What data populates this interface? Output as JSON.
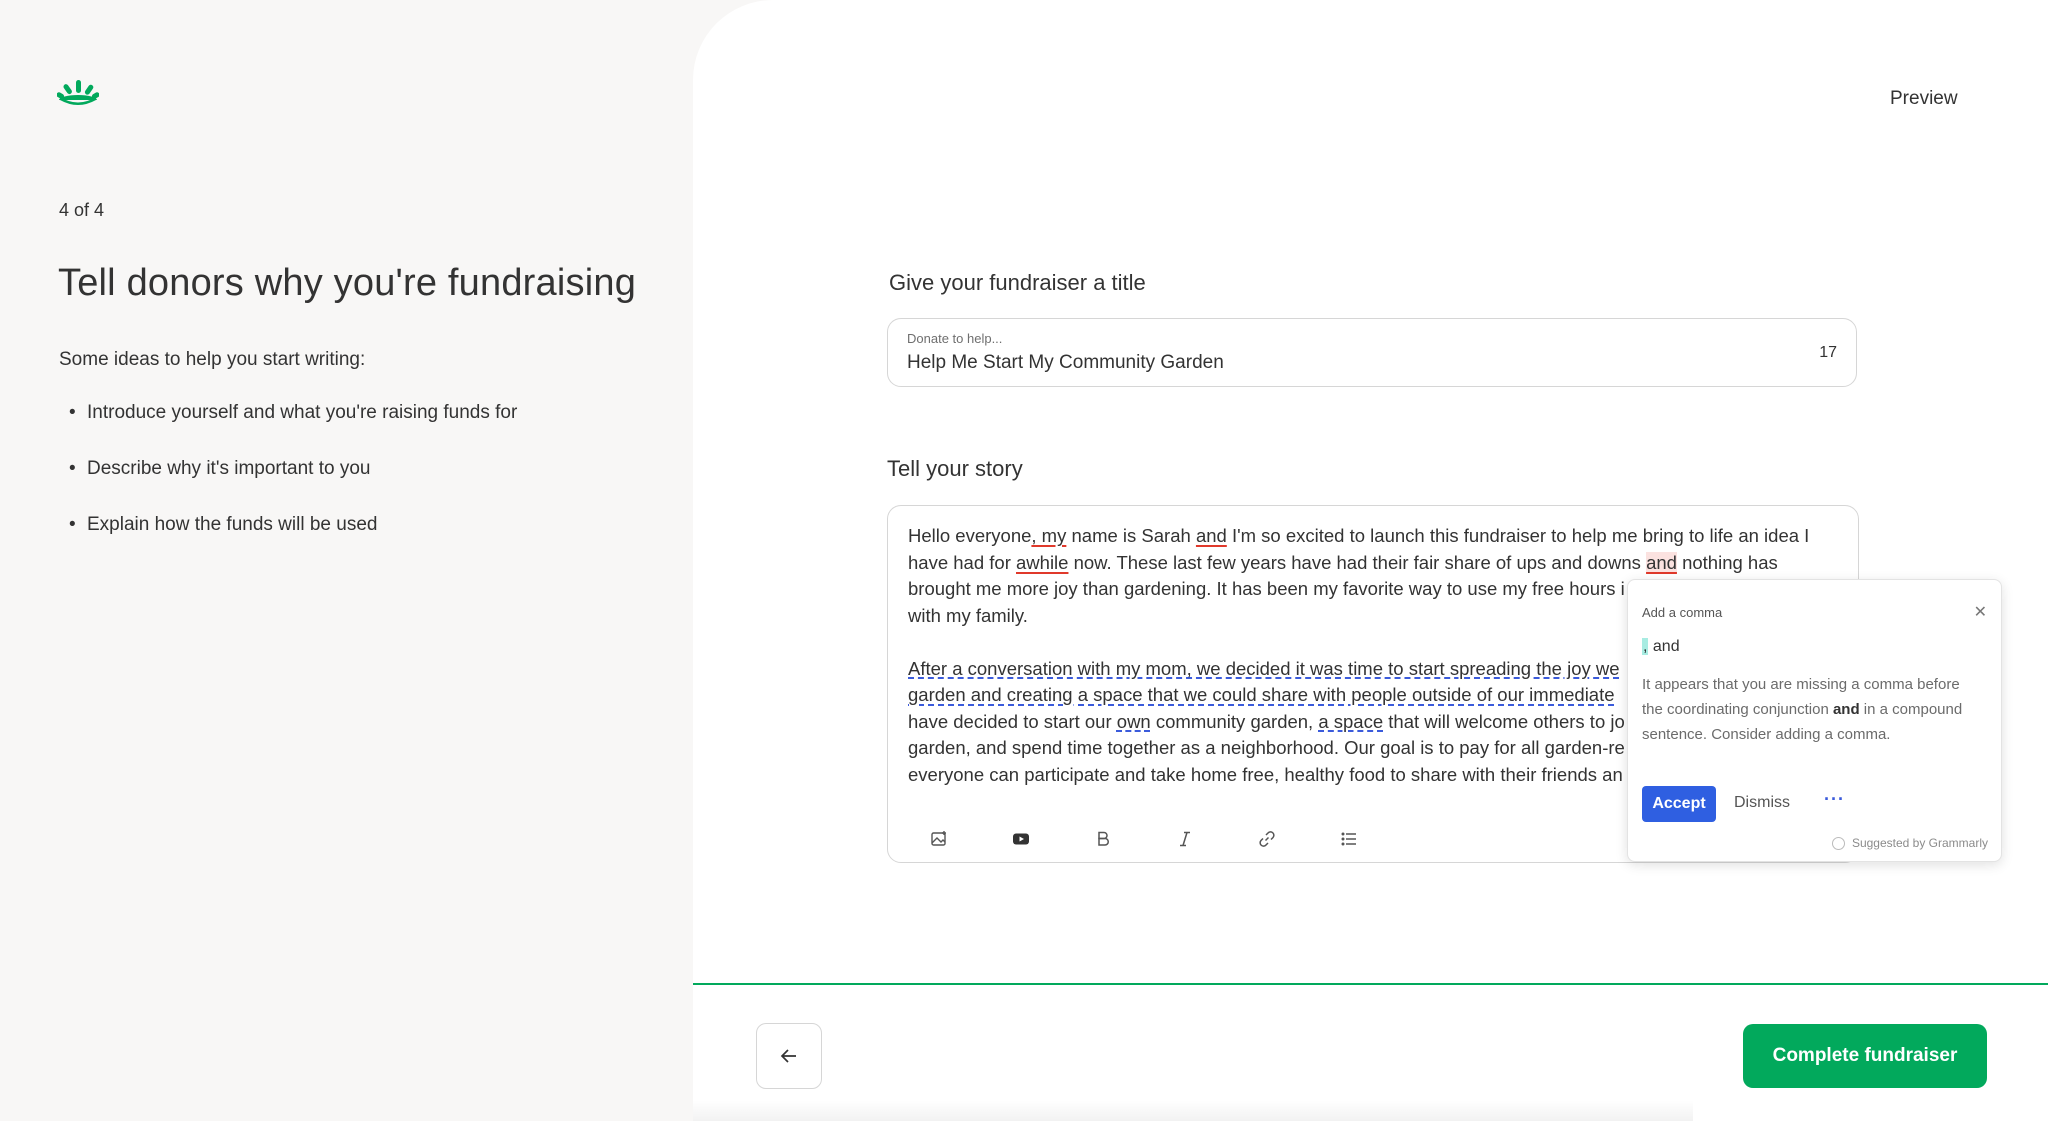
{
  "header": {
    "preview_label": "Preview"
  },
  "sidebar": {
    "step": "4 of 4",
    "heading": "Tell donors why you're fundraising",
    "ideas_label": "Some ideas to help you start writing:",
    "ideas": [
      "Introduce yourself and what you're raising funds for",
      "Describe why it's important to you",
      "Explain how the funds will be used"
    ]
  },
  "title_section": {
    "label": "Give your fundraiser a title",
    "placeholder": "Donate to help...",
    "value": "Help Me Start My Community Garden",
    "char_count": "17"
  },
  "story_section": {
    "label": "Tell your story",
    "p1": {
      "s1": "Hello everyone",
      "s2": ", my",
      "s3": " name is Sarah ",
      "s4": "and",
      "s5": " I'm so excited to launch this fundraiser to help me bring to life an idea I have had for ",
      "s6": "awhile",
      "s7": " now. These last few years have had their fair share of ups and downs ",
      "s8": "and",
      "s9": " nothing has brought me more joy than gardening. It has been my favorite way to use my free hours i",
      "s10": "with my family."
    },
    "p2": {
      "s1": "After a conversation with my mom, we decided it was time to start spreading the joy we",
      "s2": "garden and creating a space that we could share with people outside of our immediate",
      "s3": "have decided to start our ",
      "s4": "own",
      "s5": " community garden, ",
      "s6": "a space",
      "s7": " that will welcome others to jo",
      "s8": "garden, and spend time together as a neighborhood. Our goal is to pay for all garden-re",
      "s9": "everyone can participate and take home free, healthy food to share with their friends an"
    },
    "toolbar": [
      "image-icon",
      "video-icon",
      "bold-icon",
      "italic-icon",
      "link-icon",
      "list-icon"
    ]
  },
  "grammarly": {
    "title": "Add a comma",
    "suggestion_mark": ",",
    "suggestion_word": " and",
    "desc_1": "It appears that you are missing a comma before the coordinating conjunction ",
    "desc_bold": "and",
    "desc_2": " in a compound sentence. Consider adding a comma.",
    "accept_label": "Accept",
    "dismiss_label": "Dismiss",
    "more_label": "···",
    "suggested_by": "Suggested by Grammarly",
    "accent": "#2f5fe1"
  },
  "footer": {
    "complete_label": "Complete fundraiser",
    "brand_color": "#02a95c"
  }
}
